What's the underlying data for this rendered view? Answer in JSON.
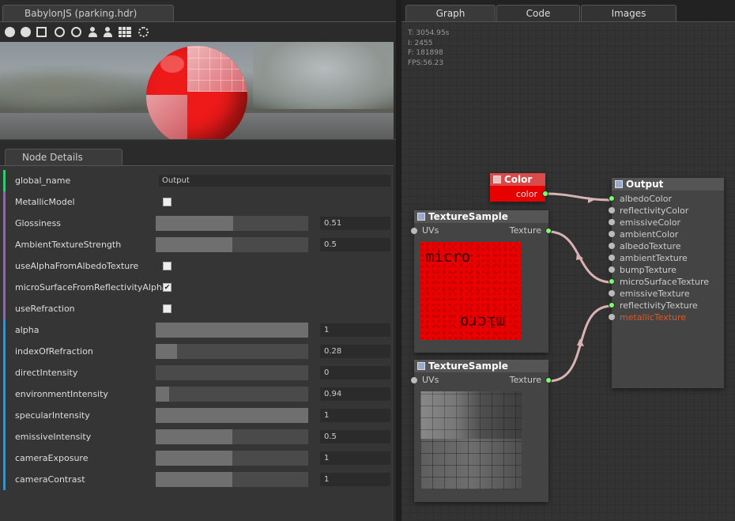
{
  "left_tab": {
    "label": "BabylonJS (parking.hdr)"
  },
  "toolbar_icons": [
    "globe-icon",
    "globe-icon",
    "cube-icon",
    "circle-icon",
    "circle-icon",
    "person-icon",
    "person-icon",
    "grid-icon",
    "spinner-icon"
  ],
  "node_details": {
    "tab_label": "Node Details",
    "rows": [
      {
        "label": "global_name",
        "type": "text",
        "value": "Output",
        "color": "#2ecc71"
      },
      {
        "label": "MetallicModel",
        "type": "checkbox",
        "checked": false,
        "color": "#8a6d9a"
      },
      {
        "label": "Glossiness",
        "type": "slider",
        "value": "0.51",
        "fraction": 0.51,
        "color": "#8a6d9a"
      },
      {
        "label": "AmbientTextureStrength",
        "type": "slider",
        "value": "0.5",
        "fraction": 0.5,
        "color": "#8a6d9a"
      },
      {
        "label": "useAlphaFromAlbedoTexture",
        "type": "checkbox",
        "checked": false,
        "color": "#8a6d9a"
      },
      {
        "label": "microSurfaceFromReflectivityAlpha",
        "type": "checkbox",
        "checked": true,
        "color": "#8a6d9a"
      },
      {
        "label": "useRefraction",
        "type": "checkbox",
        "checked": false,
        "color": "#8a6d9a"
      },
      {
        "label": "alpha",
        "type": "slider",
        "value": "1",
        "fraction": 1.0,
        "color": "#3a8fc4"
      },
      {
        "label": "indexOfRefraction",
        "type": "slider",
        "value": "0.28",
        "fraction": 0.14,
        "color": "#3a8fc4"
      },
      {
        "label": "directIntensity",
        "type": "slider",
        "value": "0",
        "fraction": 0.0,
        "color": "#3a8fc4"
      },
      {
        "label": "environmentIntensity",
        "type": "slider",
        "value": "0.94",
        "fraction": 0.09,
        "color": "#3a8fc4"
      },
      {
        "label": "specularIntensity",
        "type": "slider",
        "value": "1",
        "fraction": 1.0,
        "color": "#3a8fc4"
      },
      {
        "label": "emissiveIntensity",
        "type": "slider",
        "value": "0.5",
        "fraction": 0.5,
        "color": "#3a8fc4"
      },
      {
        "label": "cameraExposure",
        "type": "slider",
        "value": "1",
        "fraction": 0.5,
        "color": "#3a8fc4"
      },
      {
        "label": "cameraContrast",
        "type": "slider",
        "value": "1",
        "fraction": 0.5,
        "color": "#3a8fc4"
      }
    ]
  },
  "right_tabs": [
    {
      "label": "Graph",
      "active": true
    },
    {
      "label": "Code",
      "active": false
    },
    {
      "label": "Images",
      "active": false
    }
  ],
  "stats": {
    "time": "T: 3054.95s",
    "i": "I: 2455",
    "f": "F: 181898",
    "fps": "FPS:56.23"
  },
  "graph": {
    "color_node": {
      "title": "Color",
      "output": "color",
      "header_color": "#d94a4a",
      "body_color": "#e60000"
    },
    "texture_node_1": {
      "title": "TextureSample",
      "input": "UVs",
      "output": "Texture",
      "preview_text_top": "micro",
      "preview_text_bottom": "micro"
    },
    "texture_node_2": {
      "title": "TextureSample",
      "input": "UVs",
      "output": "Texture"
    },
    "output_node": {
      "title": "Output",
      "inputs": [
        {
          "label": "albedoColor",
          "connected": true
        },
        {
          "label": "reflectivityColor",
          "connected": false
        },
        {
          "label": "emissiveColor",
          "connected": false
        },
        {
          "label": "ambientColor",
          "connected": false
        },
        {
          "label": "albedoTexture",
          "connected": false
        },
        {
          "label": "ambientTexture",
          "connected": false
        },
        {
          "label": "bumpTexture",
          "connected": false
        },
        {
          "label": "microSurfaceTexture",
          "connected": true
        },
        {
          "label": "emissiveTexture",
          "connected": false
        },
        {
          "label": "reflectivityTexture",
          "connected": true
        },
        {
          "label": "metallicTexture",
          "connected": false,
          "highlight": true
        }
      ],
      "highlight_color": "#e8541e"
    },
    "wire_color": "#d9b3b3"
  }
}
